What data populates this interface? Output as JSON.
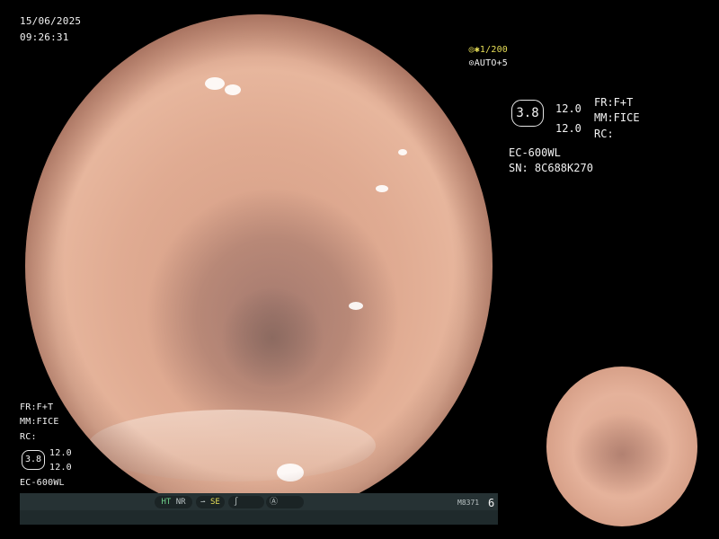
{
  "datetime": {
    "date": "15/06/2025",
    "time": "09:26:31"
  },
  "top_settings": {
    "shutter_icon": "shutter-icon",
    "shutter": "1/200",
    "auto_icon": "auto-icon",
    "auto": "AUTO+5"
  },
  "right_panel": {
    "fr": "FR:F+T",
    "mm": "MM:FICE",
    "rc": "RC:",
    "zoom_badge": "3.8",
    "val1": "12.0",
    "val2": "12.0",
    "scope": "EC-600WL",
    "serial": "SN: 8C688K270"
  },
  "left_panel": {
    "fr": "FR:F+T",
    "mm": "MM:FICE",
    "rc": "RC:",
    "zoom_badge": "3.8",
    "val1": "12.0",
    "val2": "12.0",
    "scope": "EC-600WL"
  },
  "status_bar": {
    "ht": "HT",
    "nr": "NR",
    "se": "SE",
    "code": "M8371",
    "number": "6"
  },
  "colors": {
    "text": "#f2f2f2",
    "accent_yellow": "#e8df57",
    "accent_green": "#6fd08a",
    "bar_bg": "#1f2a2c"
  }
}
